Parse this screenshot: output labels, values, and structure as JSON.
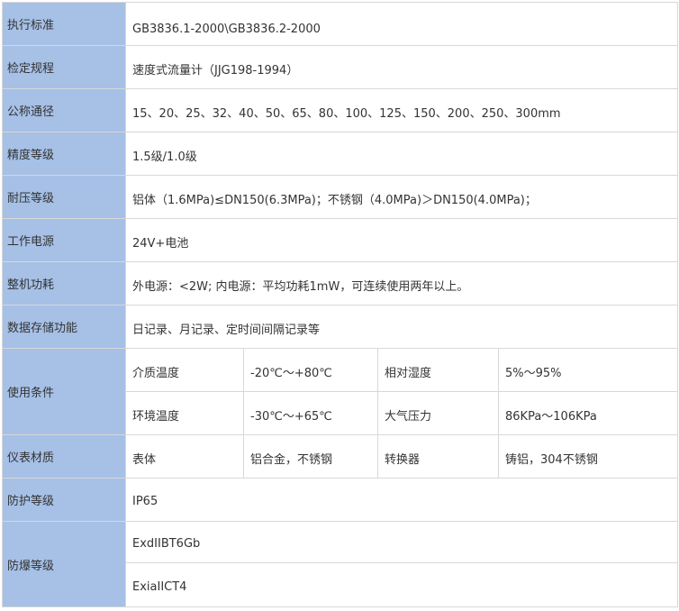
{
  "rows": {
    "standard": {
      "label": "执行标准",
      "value": "GB3836.1-2000\\GB3836.2-2000"
    },
    "verification": {
      "label": "检定规程",
      "value": "速度式流量计（JJG198-1994）"
    },
    "nominal_diameter": {
      "label": "公称通径",
      "value": "15、20、25、32、40、50、65、80、100、125、150、200、250、300mm"
    },
    "accuracy": {
      "label": "精度等级",
      "value": "1.5级/1.0级"
    },
    "pressure": {
      "label": "耐压等级",
      "value": "铝体（1.6MPa)≤DN150(6.3MPa)；不锈钢（4.0MPa)＞DN150(4.0MPa)；"
    },
    "power_supply": {
      "label": "工作电源",
      "value": "24V+电池"
    },
    "power_consumption": {
      "label": "整机功耗",
      "value": "外电源：<2W;  内电源：平均功耗1mW，可连续使用两年以上。"
    },
    "data_storage": {
      "label": "数据存储功能",
      "value": "日记录、月记录、定时间间隔记录等"
    },
    "conditions": {
      "label": "使用条件",
      "lines": [
        {
          "k1": "介质温度",
          "v1": "-20℃～+80℃",
          "k2": "相对湿度",
          "v2": "5%～95%"
        },
        {
          "k1": "环境温度",
          "v1": "-30℃～+65℃",
          "k2": "大气压力",
          "v2": "86KPa～106KPa"
        }
      ]
    },
    "material": {
      "label": "仪表材质",
      "k1": "表体",
      "v1": "铝合金，不锈钢",
      "k2": "转换器",
      "v2": "铸铝，304不锈钢"
    },
    "protection": {
      "label": "防护等级",
      "value": "IP65"
    },
    "explosion": {
      "label": "防爆等级",
      "values": [
        "ExdIIBT6Gb",
        "ExiaIICT4"
      ]
    }
  },
  "colors": {
    "label_background": "#a6c0e6",
    "border": "#d8d8d8",
    "text": "#333333"
  }
}
